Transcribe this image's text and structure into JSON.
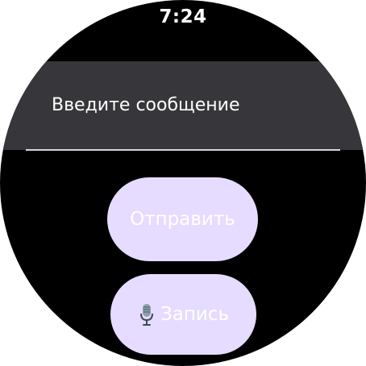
{
  "status": {
    "time": "7:24"
  },
  "message_input": {
    "placeholder": "Введите сообщение"
  },
  "actions": {
    "send_label": "Отправить",
    "record_label": "Запись",
    "record_icon": "microphone-icon"
  },
  "colors": {
    "background": "#000000",
    "input_background": "#37373b",
    "button_background": "#e6dcff",
    "button_text": "#ffffff"
  }
}
